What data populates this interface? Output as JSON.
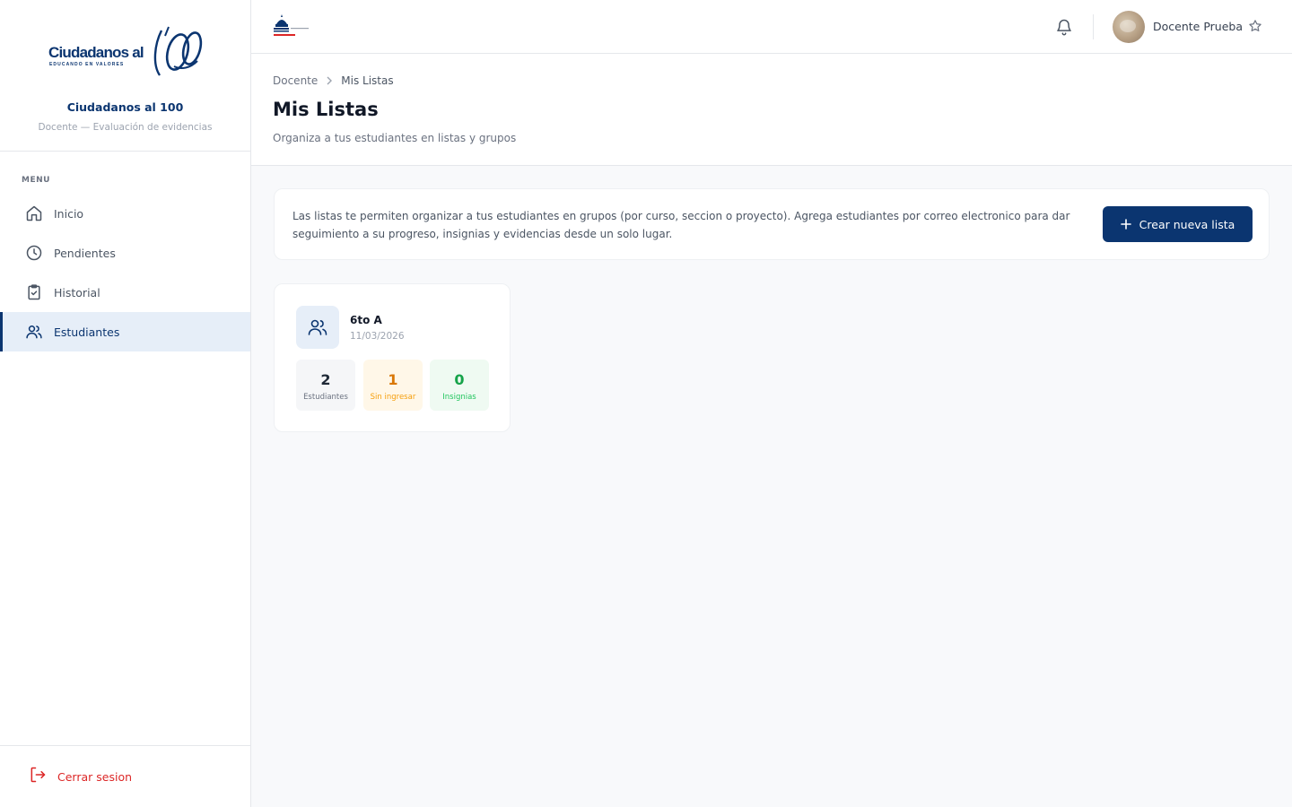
{
  "brand": {
    "logo_text": "Ciudadanos al",
    "logo_number": "100",
    "logo_tagline": "EDUCANDO EN VALORES",
    "name": "Ciudadanos al 100",
    "subtitle": "Docente — Evaluación de evidencias"
  },
  "sidebar": {
    "menu_label": "MENU",
    "items": [
      {
        "label": "Inicio",
        "icon": "home-icon"
      },
      {
        "label": "Pendientes",
        "icon": "clock-icon"
      },
      {
        "label": "Historial",
        "icon": "clipboard-check-icon"
      },
      {
        "label": "Estudiantes",
        "icon": "users-icon",
        "active": true
      }
    ],
    "logout_label": "Cerrar sesion"
  },
  "topbar": {
    "user_name": "Docente Prueba"
  },
  "breadcrumb": [
    "Docente",
    "Mis Listas"
  ],
  "page": {
    "title": "Mis Listas",
    "subtitle": "Organiza a tus estudiantes en listas y grupos"
  },
  "info": {
    "text": "Las listas te permiten organizar a tus estudiantes en grupos (por curso, seccion o proyecto). Agrega estudiantes por correo electronico para dar seguimiento a su progreso, insignias y evidencias desde un solo lugar.",
    "create_label": "Crear nueva lista"
  },
  "lists": [
    {
      "name": "6to A",
      "date": "11/03/2026",
      "stats": [
        {
          "value": "2",
          "label": "Estudiantes"
        },
        {
          "value": "1",
          "label": "Sin ingresar"
        },
        {
          "value": "0",
          "label": "Insignias"
        }
      ]
    }
  ],
  "colors": {
    "primary": "#0b3570",
    "active_bg": "#e6eef8",
    "danger": "#dc2626",
    "warning": "#d97706",
    "success": "#16a34a"
  }
}
